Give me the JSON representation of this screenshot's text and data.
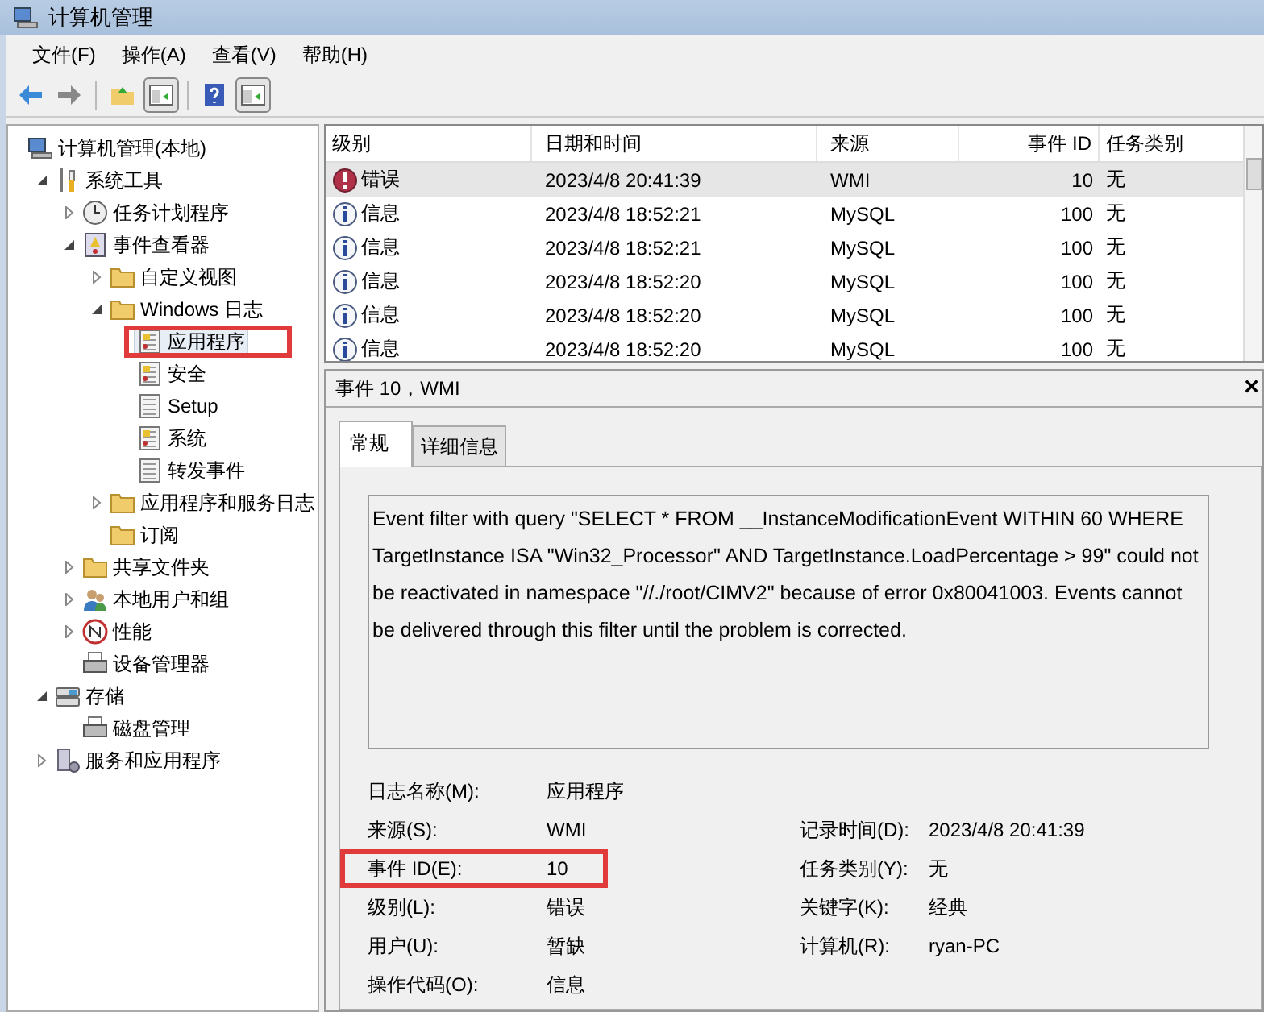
{
  "window": {
    "title": "计算机管理"
  },
  "menu": [
    "文件(F)",
    "操作(A)",
    "查看(V)",
    "帮助(H)"
  ],
  "toolbar": [
    {
      "kind": "back",
      "pressed": false
    },
    {
      "kind": "forward",
      "pressed": false
    },
    {
      "kind": "separator"
    },
    {
      "kind": "up",
      "pressed": false
    },
    {
      "kind": "pane",
      "pressed": true
    },
    {
      "kind": "separator"
    },
    {
      "kind": "help",
      "pressed": false
    },
    {
      "kind": "pane2",
      "pressed": true
    }
  ],
  "tree": [
    {
      "label": "计算机管理(本地)",
      "kind": "computer",
      "selected": false,
      "children": [
        {
          "label": "系统工具",
          "kind": "tools",
          "expanded": true,
          "selected": false,
          "children": [
            {
              "label": "任务计划程序",
              "kind": "clock",
              "expanded": false,
              "selected": false
            },
            {
              "label": "事件查看器",
              "kind": "viewer",
              "expanded": true,
              "selected": false,
              "children": [
                {
                  "label": "自定义视图",
                  "kind": "folder",
                  "expanded": false,
                  "selected": false
                },
                {
                  "label": "Windows 日志",
                  "kind": "folder",
                  "expanded": true,
                  "selected": false,
                  "children": [
                    {
                      "label": "应用程序",
                      "kind": "log",
                      "selected": true,
                      "highlighted": true
                    },
                    {
                      "label": "安全",
                      "kind": "log",
                      "selected": false
                    },
                    {
                      "label": "Setup",
                      "kind": "plainlog",
                      "selected": false
                    },
                    {
                      "label": "系统",
                      "kind": "log",
                      "selected": false
                    },
                    {
                      "label": "转发事件",
                      "kind": "plainlog",
                      "selected": false
                    }
                  ]
                },
                {
                  "label": "应用程序和服务日志",
                  "kind": "folder",
                  "expanded": false,
                  "selected": false
                },
                {
                  "label": "订阅",
                  "kind": "folder",
                  "selected": false
                }
              ]
            },
            {
              "label": "共享文件夹",
              "kind": "folder",
              "expanded": false,
              "selected": false
            },
            {
              "label": "本地用户和组",
              "kind": "users",
              "expanded": false,
              "selected": false
            },
            {
              "label": "性能",
              "kind": "perf",
              "expanded": false,
              "selected": false
            },
            {
              "label": "设备管理器",
              "kind": "device",
              "selected": false
            }
          ]
        },
        {
          "label": "存储",
          "kind": "storage",
          "expanded": true,
          "selected": false,
          "children": [
            {
              "label": "磁盘管理",
              "kind": "device",
              "selected": false
            }
          ]
        },
        {
          "label": "服务和应用程序",
          "kind": "services",
          "expanded": false,
          "selected": false
        }
      ]
    }
  ],
  "events": {
    "columns": [
      "级别",
      "日期和时间",
      "来源",
      "事件 ID",
      "任务类别"
    ],
    "rows": [
      {
        "kind": "error",
        "level": "错误",
        "datetime": "2023/4/8 20:41:39",
        "source": "WMI",
        "event_id": "10",
        "category": "无",
        "selected": true
      },
      {
        "kind": "info",
        "level": "信息",
        "datetime": "2023/4/8 18:52:21",
        "source": "MySQL",
        "event_id": "100",
        "category": "无",
        "selected": false
      },
      {
        "kind": "info",
        "level": "信息",
        "datetime": "2023/4/8 18:52:21",
        "source": "MySQL",
        "event_id": "100",
        "category": "无",
        "selected": false
      },
      {
        "kind": "info",
        "level": "信息",
        "datetime": "2023/4/8 18:52:20",
        "source": "MySQL",
        "event_id": "100",
        "category": "无",
        "selected": false
      },
      {
        "kind": "info",
        "level": "信息",
        "datetime": "2023/4/8 18:52:20",
        "source": "MySQL",
        "event_id": "100",
        "category": "无",
        "selected": false
      },
      {
        "kind": "info",
        "level": "信息",
        "datetime": "2023/4/8 18:52:20",
        "source": "MySQL",
        "event_id": "100",
        "category": "无",
        "selected": false
      }
    ]
  },
  "detail": {
    "title": "事件 10，WMI",
    "close": "×",
    "tabs": [
      {
        "label": "常规",
        "selected": true
      },
      {
        "label": "详细信息",
        "selected": false
      }
    ],
    "message": "Event filter with query \"SELECT * FROM __InstanceModificationEvent WITHIN 60 WHERE TargetInstance ISA \"Win32_Processor\" AND TargetInstance.LoadPercentage > 99\" could not be reactivated in namespace \"//./root/CIMV2\" because of error 0x80041003. Events cannot be delivered through this filter until the problem is corrected.",
    "fields": [
      {
        "left": {
          "label": "日志名称(M):",
          "value": "应用程序"
        }
      },
      {
        "left": {
          "label": "来源(S):",
          "value": "WMI"
        },
        "right": {
          "label": "记录时间(D):",
          "value": "2023/4/8 20:41:39"
        }
      },
      {
        "left": {
          "label": "事件 ID(E):",
          "value": "10",
          "highlighted": true
        },
        "right": {
          "label": "任务类别(Y):",
          "value": "无"
        }
      },
      {
        "left": {
          "label": "级别(L):",
          "value": "错误"
        },
        "right": {
          "label": "关键字(K):",
          "value": "经典"
        }
      },
      {
        "left": {
          "label": "用户(U):",
          "value": "暂缺"
        },
        "right": {
          "label": "计算机(R):",
          "value": "ryan-PC"
        }
      },
      {
        "left": {
          "label": "操作代码(O):",
          "value": "信息"
        }
      }
    ]
  }
}
